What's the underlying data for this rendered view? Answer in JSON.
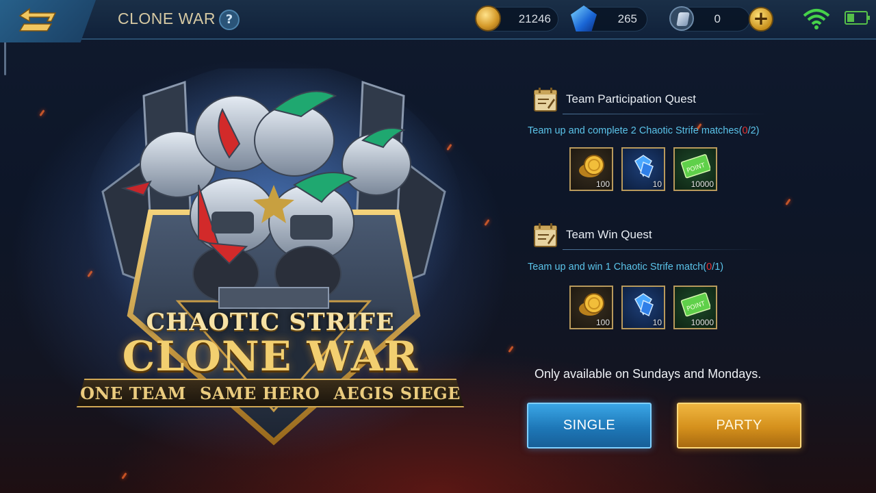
{
  "header": {
    "title": "CLONE WAR",
    "help_label": "?",
    "back_icon": "back-arrow-icon"
  },
  "currencies": [
    {
      "name": "gold",
      "icon": "gold-coin-icon",
      "value": "21246"
    },
    {
      "name": "diamond",
      "icon": "diamond-icon",
      "value": "265"
    },
    {
      "name": "voucher",
      "icon": "voucher-icon",
      "value": "0"
    }
  ],
  "topup_label": "+",
  "status": {
    "wifi_icon": "wifi-icon",
    "battery_icon": "battery-icon"
  },
  "event_logo": {
    "line1": "CHAOTIC STRIFE",
    "line2": "CLONE WAR",
    "tags": [
      "ONE TEAM",
      "SAME HERO",
      "AEGIS SIEGE"
    ]
  },
  "quests": [
    {
      "title": "Team Participation Quest",
      "desc_prefix": "Team up and complete 2 Chaotic Strife matches(",
      "progress_current": "0",
      "progress_suffix": "/2)",
      "rewards": [
        {
          "type": "gold",
          "amount": "100"
        },
        {
          "type": "diamond",
          "amount": "10"
        },
        {
          "type": "point",
          "amount": "10000"
        }
      ]
    },
    {
      "title": "Team Win Quest",
      "desc_prefix": "Team up and win 1 Chaotic Strife match(",
      "progress_current": "0",
      "progress_suffix": "/1)",
      "rewards": [
        {
          "type": "gold",
          "amount": "100"
        },
        {
          "type": "diamond",
          "amount": "10"
        },
        {
          "type": "point",
          "amount": "10000"
        }
      ]
    }
  ],
  "availability": "Only available on Sundays and Mondays.",
  "buttons": {
    "single": "SINGLE",
    "party": "PARTY"
  },
  "colors": {
    "progress_current": "#e23232",
    "quest_desc": "#5bc4ea",
    "single_button": "#1e78b8",
    "party_button": "#d4901c"
  }
}
